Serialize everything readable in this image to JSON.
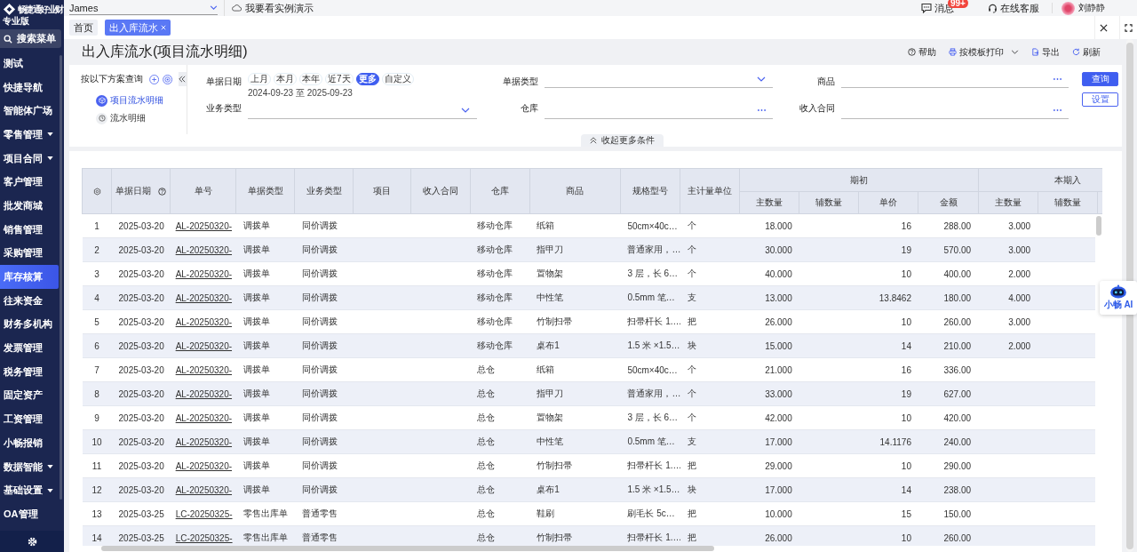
{
  "brand": {
    "name": "畅捷通好业财",
    "edition": "专业版"
  },
  "sidebar": {
    "search": "搜索菜单",
    "items": [
      {
        "label": "测试",
        "has_submenu": false,
        "selected": false
      },
      {
        "label": "快捷导航",
        "has_submenu": false,
        "selected": false
      },
      {
        "label": "智能体广场",
        "has_submenu": false,
        "selected": false
      },
      {
        "label": "零售管理",
        "has_submenu": true,
        "selected": false
      },
      {
        "label": "项目合同",
        "has_submenu": true,
        "selected": false
      },
      {
        "label": "客户管理",
        "has_submenu": false,
        "selected": false
      },
      {
        "label": "批发商城",
        "has_submenu": false,
        "selected": false
      },
      {
        "label": "销售管理",
        "has_submenu": false,
        "selected": false
      },
      {
        "label": "采购管理",
        "has_submenu": false,
        "selected": false
      },
      {
        "label": "库存核算",
        "has_submenu": false,
        "selected": true
      },
      {
        "label": "往来资金",
        "has_submenu": false,
        "selected": false
      },
      {
        "label": "财务多机构",
        "has_submenu": false,
        "selected": false
      },
      {
        "label": "发票管理",
        "has_submenu": false,
        "selected": false
      },
      {
        "label": "税务管理",
        "has_submenu": false,
        "selected": false
      },
      {
        "label": "固定资产",
        "has_submenu": false,
        "selected": false
      },
      {
        "label": "工资管理",
        "has_submenu": false,
        "selected": false
      },
      {
        "label": "小畅报销",
        "has_submenu": false,
        "selected": false
      },
      {
        "label": "数据智能",
        "has_submenu": true,
        "selected": false
      },
      {
        "label": "基础设置",
        "has_submenu": true,
        "selected": false
      },
      {
        "label": "OA管理",
        "has_submenu": false,
        "selected": false
      }
    ]
  },
  "topbar": {
    "account": "James",
    "demo_link": "我要看实例演示",
    "messages": {
      "label": "消息",
      "badge": "99+"
    },
    "support": "在线客服",
    "user": "刘静静"
  },
  "tabs": [
    {
      "label": "首页",
      "selected": false,
      "closable": false
    },
    {
      "label": "出入库流水",
      "selected": true,
      "closable": true
    }
  ],
  "page": {
    "title": "出入库流水(项目流水明细)",
    "toolbar": [
      {
        "label": "帮助",
        "kind": "help",
        "dropdown": false
      },
      {
        "label": "按模板打印",
        "kind": "print",
        "dropdown": true
      },
      {
        "label": "导出",
        "kind": "export",
        "dropdown": false
      },
      {
        "label": "刷新",
        "kind": "refresh",
        "dropdown": false
      }
    ]
  },
  "schemes": {
    "title": "按以下方案查询",
    "items": [
      {
        "label": "项目流水明细",
        "selected": true
      },
      {
        "label": "流水明细",
        "selected": false
      }
    ]
  },
  "filters": {
    "date": {
      "label": "单据日期",
      "presets": [
        {
          "label": "上月",
          "selected": false
        },
        {
          "label": "本月",
          "selected": false
        },
        {
          "label": "本年",
          "selected": false
        },
        {
          "label": "近7天",
          "selected": false
        },
        {
          "label": "更多",
          "selected": true
        },
        {
          "label": "自定义",
          "selected": false
        }
      ],
      "range": "2024-09-23 至 2025-09-23"
    },
    "fields": [
      {
        "label": "单据类型",
        "kind": "select"
      },
      {
        "label": "商品",
        "kind": "lookup"
      },
      {
        "label": "业务类型",
        "kind": "select"
      },
      {
        "label": "仓库",
        "kind": "lookup"
      },
      {
        "label": "收入合同",
        "kind": "lookup"
      }
    ],
    "buttons": [
      {
        "label": "查询",
        "kind": "primary"
      },
      {
        "label": "设置",
        "kind": "secondary"
      }
    ],
    "collapse": "收起更多条件"
  },
  "table": {
    "columns": [
      {
        "kind": "settings"
      },
      {
        "label": "单据日期",
        "kind": "help"
      },
      {
        "label": "单号",
        "kind": "link"
      },
      {
        "label": "单据类型",
        "kind": "text"
      },
      {
        "label": "业务类型",
        "kind": "text"
      },
      {
        "label": "项目",
        "kind": "text"
      },
      {
        "label": "收入合同",
        "kind": "text"
      },
      {
        "label": "仓库",
        "kind": "text"
      },
      {
        "label": "商品",
        "kind": "text"
      },
      {
        "label": "规格型号",
        "kind": "text"
      },
      {
        "label": "主计量单位",
        "kind": "text"
      }
    ],
    "groups": [
      {
        "label": "期初",
        "columns": [
          {
            "label": "主数量"
          },
          {
            "label": "辅数量"
          },
          {
            "label": "单价"
          },
          {
            "label": "金额"
          }
        ]
      },
      {
        "label": "本期入",
        "columns": [
          {
            "label": "主数量"
          },
          {
            "label": "辅数量"
          }
        ]
      }
    ],
    "rows": [
      [
        "1",
        "2025-03-20",
        "AL-20250320-",
        "调拨单",
        "同价调拨",
        null,
        null,
        "移动仓库",
        "纸箱",
        "50cm×40c…",
        "个",
        "18.000",
        null,
        "16",
        "288.00",
        "3.000"
      ],
      [
        "2",
        "2025-03-20",
        "AL-20250320-",
        "调拨单",
        "同价调拨",
        null,
        null,
        "移动仓库",
        "指甲刀",
        "普通家用，…",
        "个",
        "30.000",
        null,
        "19",
        "570.00",
        "3.000"
      ],
      [
        "3",
        "2025-03-20",
        "AL-20250320-",
        "调拨单",
        "同价调拨",
        null,
        null,
        "移动仓库",
        "置物架",
        "3 层，长 6…",
        "个",
        "40.000",
        null,
        "10",
        "400.00",
        "2.000"
      ],
      [
        "4",
        "2025-03-20",
        "AL-20250320-",
        "调拨单",
        "同价调拨",
        null,
        null,
        "移动仓库",
        "中性笔",
        "0.5mm 笔…",
        "支",
        "13.000",
        null,
        "13.8462",
        "180.00",
        "4.000"
      ],
      [
        "5",
        "2025-03-20",
        "AL-20250320-",
        "调拨单",
        "同价调拨",
        null,
        null,
        "移动仓库",
        "竹制扫帚",
        "扫帚杆长 1.…",
        "把",
        "26.000",
        null,
        "10",
        "260.00",
        "3.000"
      ],
      [
        "6",
        "2025-03-20",
        "AL-20250320-",
        "调拨单",
        "同价调拨",
        null,
        null,
        "移动仓库",
        "桌布1",
        "1.5 米 ×1.5…",
        "块",
        "15.000",
        null,
        "14",
        "210.00",
        "2.000"
      ],
      [
        "7",
        "2025-03-20",
        "AL-20250320-",
        "调拨单",
        "同价调拨",
        null,
        null,
        "总仓",
        "纸箱",
        "50cm×40c…",
        "个",
        "21.000",
        null,
        "16",
        "336.00"
      ],
      [
        "8",
        "2025-03-20",
        "AL-20250320-",
        "调拨单",
        "同价调拨",
        null,
        null,
        "总仓",
        "指甲刀",
        "普通家用，…",
        "个",
        "33.000",
        null,
        "19",
        "627.00"
      ],
      [
        "9",
        "2025-03-20",
        "AL-20250320-",
        "调拨单",
        "同价调拨",
        null,
        null,
        "总仓",
        "置物架",
        "3 层，长 6…",
        "个",
        "42.000",
        null,
        "10",
        "420.00"
      ],
      [
        "10",
        "2025-03-20",
        "AL-20250320-",
        "调拨单",
        "同价调拨",
        null,
        null,
        "总仓",
        "中性笔",
        "0.5mm 笔…",
        "支",
        "17.000",
        null,
        "14.1176",
        "240.00"
      ],
      [
        "11",
        "2025-03-20",
        "AL-20250320-",
        "调拨单",
        "同价调拨",
        null,
        null,
        "总仓",
        "竹制扫帚",
        "扫帚杆长 1.…",
        "把",
        "29.000",
        null,
        "10",
        "290.00"
      ],
      [
        "12",
        "2025-03-20",
        "AL-20250320-",
        "调拨单",
        "同价调拨",
        null,
        null,
        "总仓",
        "桌布1",
        "1.5 米 ×1.5…",
        "块",
        "17.000",
        null,
        "14",
        "238.00"
      ],
      [
        "13",
        "2025-03-25",
        "LC-20250325-",
        "零售出库单",
        "普通零售",
        null,
        null,
        "总仓",
        "鞋刷",
        "刷毛长 5c…",
        "把",
        "10.000",
        null,
        "15",
        "150.00"
      ],
      [
        "14",
        "2025-03-25",
        "LC-20250325-",
        "零售出库单",
        "普通零售",
        null,
        null,
        "总仓",
        "竹制扫帚",
        "扫帚杆长 1.…",
        "把",
        "26.000",
        null,
        "10",
        "260.00"
      ]
    ]
  },
  "assistant": {
    "label": "小畅 AI"
  }
}
